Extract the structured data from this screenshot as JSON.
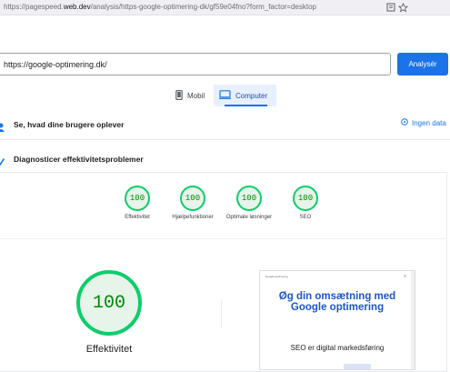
{
  "browser": {
    "url_prefix": "https://pagespeed.",
    "url_domain": "web.dev",
    "url_path": "/analysis/https-google-optimering-dk/gf59e04fno?form_factor=desktop",
    "icons": [
      "reader-icon",
      "star-icon"
    ]
  },
  "search": {
    "value": "https://google-optimering.dk/",
    "analyze_label": "Analysér"
  },
  "tabs": [
    {
      "label": "Mobil",
      "icon": "mobile-icon",
      "selected": false
    },
    {
      "label": "Computer",
      "icon": "desktop-icon",
      "selected": true
    }
  ],
  "sections": {
    "field_title": "Se, hvad dine brugere oplever",
    "no_data": "Ingen data",
    "diagnose_title": "Diagnosticer effektivitetsproblemer"
  },
  "scores": [
    {
      "label": "Effektivitet",
      "value": "100"
    },
    {
      "label": "Hjælpefunktioner",
      "value": "100"
    },
    {
      "label": "Optimale løsninger",
      "value": "100"
    },
    {
      "label": "SEO",
      "value": "100"
    }
  ],
  "main_score": {
    "value": "100",
    "label": "Effektivitet"
  },
  "preview": {
    "site_name": "Google-optimering",
    "headline": "Øg din omsætning med Google optimering",
    "subtitle": "SEO er digital markedsføring"
  },
  "colors": {
    "accent": "#1a73e8",
    "pass": "#0cce6b",
    "pass_text": "#008800"
  }
}
